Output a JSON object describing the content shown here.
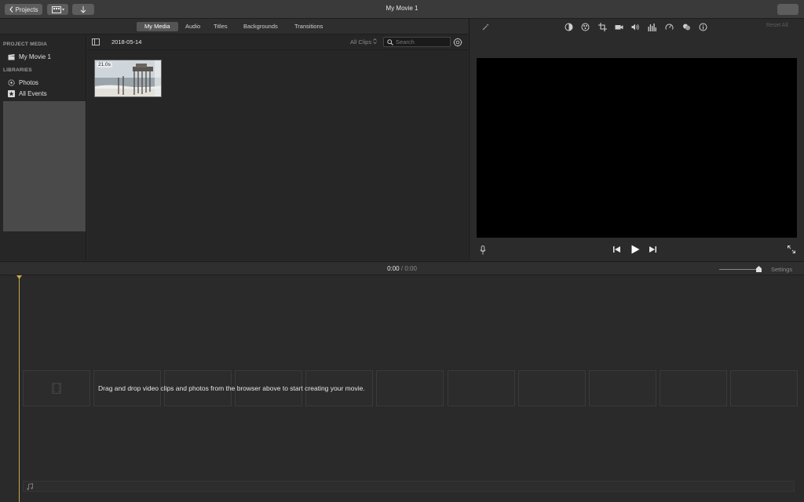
{
  "window": {
    "title": "My Movie 1"
  },
  "toolbar": {
    "projects_label": "Projects",
    "right_button_label": ""
  },
  "tabs": [
    {
      "label": "My Media",
      "active": true
    },
    {
      "label": "Audio",
      "active": false
    },
    {
      "label": "Titles",
      "active": false
    },
    {
      "label": "Backgrounds",
      "active": false
    },
    {
      "label": "Transitions",
      "active": false
    }
  ],
  "sidebar": {
    "project_heading": "PROJECT MEDIA",
    "project_items": [
      {
        "label": "My Movie 1",
        "icon": "clapperboard-icon"
      }
    ],
    "libraries_heading": "LIBRARIES",
    "library_items": [
      {
        "label": "Photos",
        "icon": "photos-flower-icon"
      },
      {
        "label": "All Events",
        "icon": "star-icon"
      }
    ]
  },
  "browser": {
    "date": "2018-05-14",
    "filter_value": "All Clips",
    "search_placeholder": "Search",
    "clips": [
      {
        "duration": "21.0s"
      }
    ]
  },
  "viewer": {
    "reset_label": "Reset All"
  },
  "timeline": {
    "current_time": "0:00",
    "separator": "/",
    "total_time": "0:00",
    "settings_label": "Settings",
    "empty_message": "Drag and drop video clips and photos from the browser above to start creating your movie."
  },
  "colors": {
    "accent_playhead": "#c9a84c",
    "active_tab": "#555555",
    "background": "#2b2b2b"
  }
}
